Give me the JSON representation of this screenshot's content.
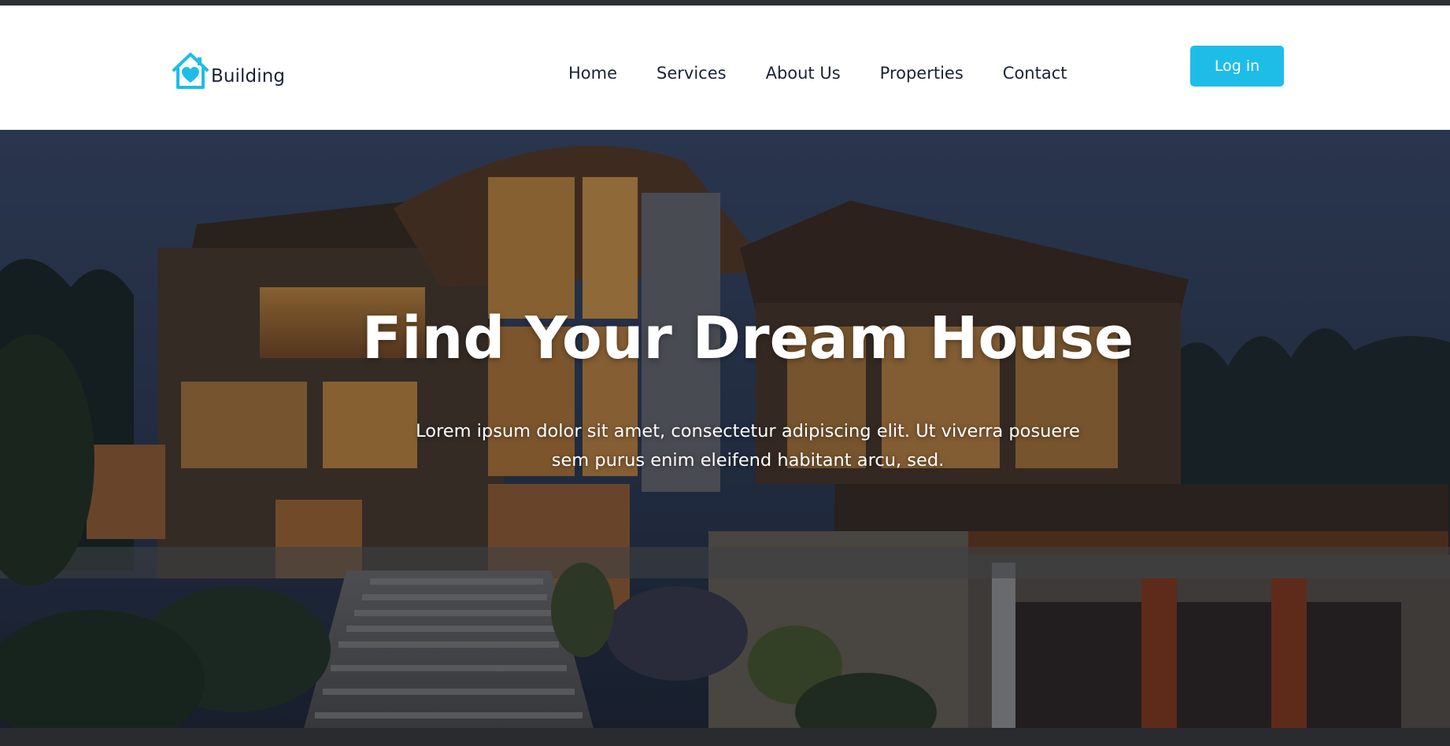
{
  "brand": {
    "name": "Building",
    "accent_color": "#1ebde8",
    "icon": "house-heart-icon"
  },
  "nav": {
    "items": [
      {
        "label": "Home"
      },
      {
        "label": "Services"
      },
      {
        "label": "About Us"
      },
      {
        "label": "Properties"
      },
      {
        "label": "Contact"
      }
    ],
    "login_label": "Log in"
  },
  "hero": {
    "title": "Find Your Dream House",
    "subtitle": "Lorem ipsum dolor sit amet, consectetur adipiscing elit. Ut viverra posuere sem purus enim eleifend habitant arcu, sed.",
    "background": "modern-house-at-dusk-image"
  },
  "colors": {
    "text_dark": "#1b2238",
    "button_bg": "#1ebde8",
    "top_strip": "#2e3036"
  }
}
